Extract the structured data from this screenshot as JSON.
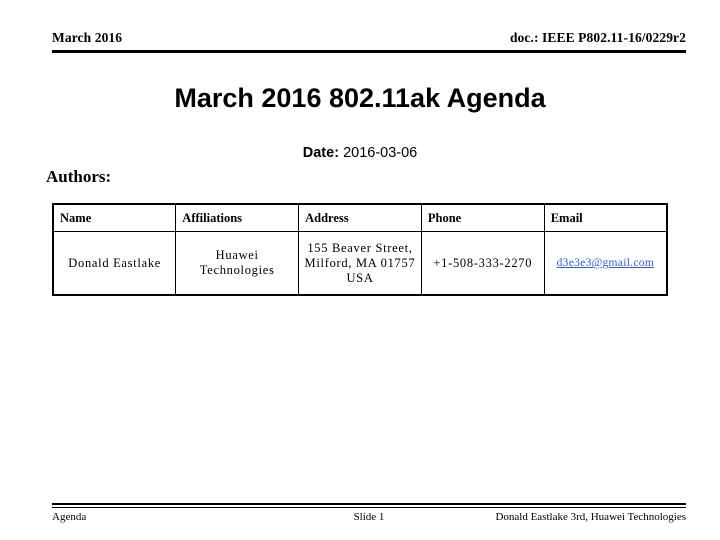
{
  "header": {
    "left": "March 2016",
    "right": "doc.: IEEE P802.11-16/0229r2"
  },
  "title": "March 2016 802.11ak Agenda",
  "date": {
    "label": "Date:",
    "value": "2016-03-06"
  },
  "authors": {
    "section_label": "Authors:",
    "columns": [
      "Name",
      "Affiliations",
      "Address",
      "Phone",
      "Email"
    ],
    "rows": [
      {
        "name": "Donald Eastlake",
        "affiliations": "Huawei Technologies",
        "address": "155 Beaver Street, Milford, MA 01757 USA",
        "phone": "+1-508-333-2270",
        "email": "d3e3e3@gmail.com"
      }
    ]
  },
  "footer": {
    "left": "Agenda",
    "center": "Slide 1",
    "right": "Donald Eastlake 3rd, Huawei Technologies"
  },
  "colors": {
    "link": "#2b5fd9",
    "rule": "#000000",
    "text": "#000000",
    "background": "#ffffff"
  }
}
